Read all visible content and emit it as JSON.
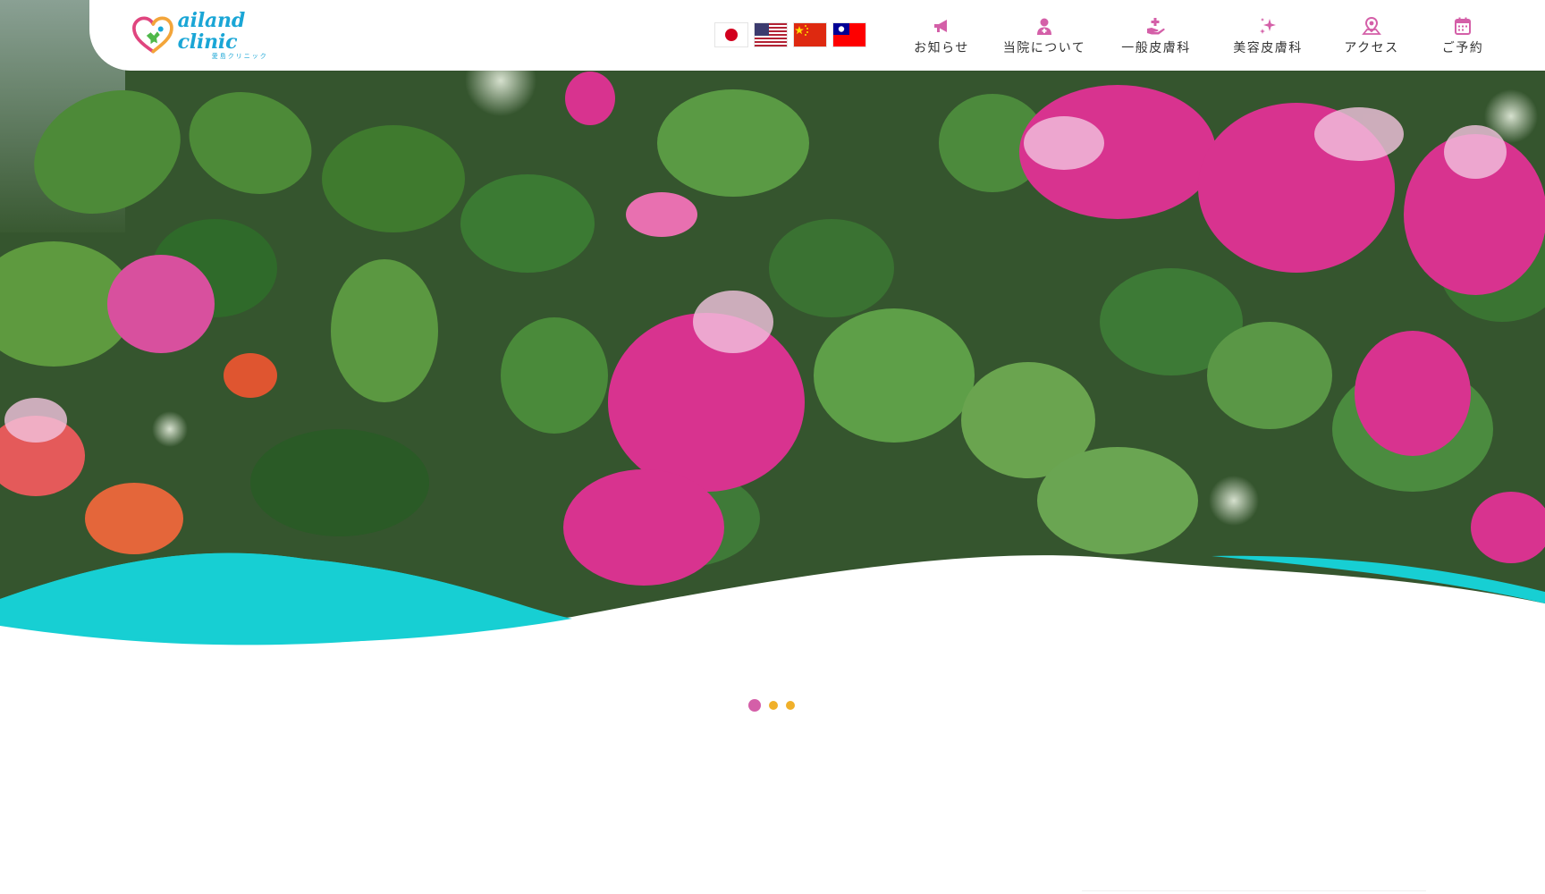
{
  "header": {
    "logo": {
      "name": "ailand clinic",
      "subtitle": "愛島クリニック"
    },
    "languages": [
      {
        "code": "ja",
        "icon": "flag-japan"
      },
      {
        "code": "en",
        "icon": "flag-usa"
      },
      {
        "code": "zh-cn",
        "icon": "flag-china"
      },
      {
        "code": "zh-tw",
        "icon": "flag-taiwan"
      }
    ],
    "nav": [
      {
        "label": "お知らせ",
        "icon": "megaphone-icon"
      },
      {
        "label": "当院について",
        "icon": "doctor-icon"
      },
      {
        "label": "一般皮膚科",
        "icon": "medical-hand-icon"
      },
      {
        "label": "美容皮膚科",
        "icon": "sparkle-icon"
      },
      {
        "label": "アクセス",
        "icon": "map-pin-icon"
      },
      {
        "label": "ご予約",
        "icon": "calendar-icon"
      }
    ]
  },
  "carousel": {
    "slides": 3,
    "active_index": 0
  },
  "colors": {
    "accent_pink": "#d45fa8",
    "accent_teal": "#17cfd3",
    "dot_yellow": "#f0b02a",
    "logo_blue": "#1aa6d6"
  }
}
